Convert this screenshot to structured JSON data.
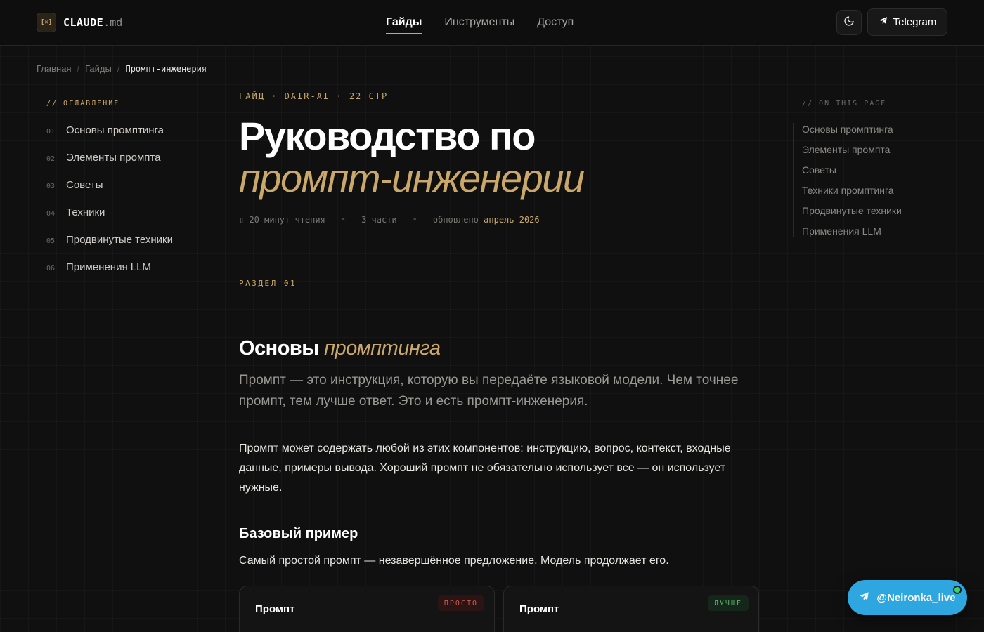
{
  "header": {
    "logo_mark": "[✕]",
    "logo_name": "CLAUDE",
    "logo_ext": ".md",
    "nav": [
      "Гайды",
      "Инструменты",
      "Доступ"
    ],
    "telegram_label": "Telegram"
  },
  "breadcrumb": [
    "Главная",
    "Гайды",
    "Промпт-инженерия"
  ],
  "toc_left": {
    "heading": "// ОГЛАВЛЕНИЕ",
    "items": [
      {
        "num": "01",
        "label": "Основы промптинга"
      },
      {
        "num": "02",
        "label": "Элементы промпта"
      },
      {
        "num": "03",
        "label": "Советы"
      },
      {
        "num": "04",
        "label": "Техники"
      },
      {
        "num": "05",
        "label": "Продвинутые техники"
      },
      {
        "num": "06",
        "label": "Применения LLM"
      }
    ]
  },
  "toc_right": {
    "heading": "// ON THIS PAGE",
    "items": [
      "Основы промптинга",
      "Элементы промпта",
      "Советы",
      "Техники промптинга",
      "Продвинутые техники",
      "Применения LLM"
    ]
  },
  "article": {
    "meta_top": "ГАЙД · DAIR-AI · 22 СТР",
    "title_line1": "Руководство по",
    "title_line2": "промпт-инженерии",
    "read_time": "▯ 20 минут чтения",
    "parts": "3 части",
    "updated_prefix": "обновлено",
    "updated_date": "апрель 2026",
    "section_label": "РАЗДЕЛ 01",
    "h2_plain": "Основы",
    "h2_accent": "промптинга",
    "lead": "Промпт — это инструкция, которую вы передаёте языковой модели. Чем точнее промпт, тем лучше ответ. Это и есть промпт-инженерия.",
    "paragraph": "Промпт может содержать любой из этих компонентов: инструкцию, вопрос, контекст, входные данные, примеры вывода. Хороший промпт не обязательно использует все — он использует нужные.",
    "h3": "Базовый пример",
    "paragraph2": "Самый простой промпт — незавершённое предложение. Модель продолжает его.",
    "cards": [
      {
        "title": "Промпт",
        "badge": "ПРОСТО"
      },
      {
        "title": "Промпт",
        "badge": "ЛУЧШЕ"
      }
    ]
  },
  "floating": {
    "handle": "@Neironka_live"
  },
  "colors": {
    "accent": "#c9a86a",
    "telegram": "#2ea6e0",
    "background": "#101010"
  }
}
